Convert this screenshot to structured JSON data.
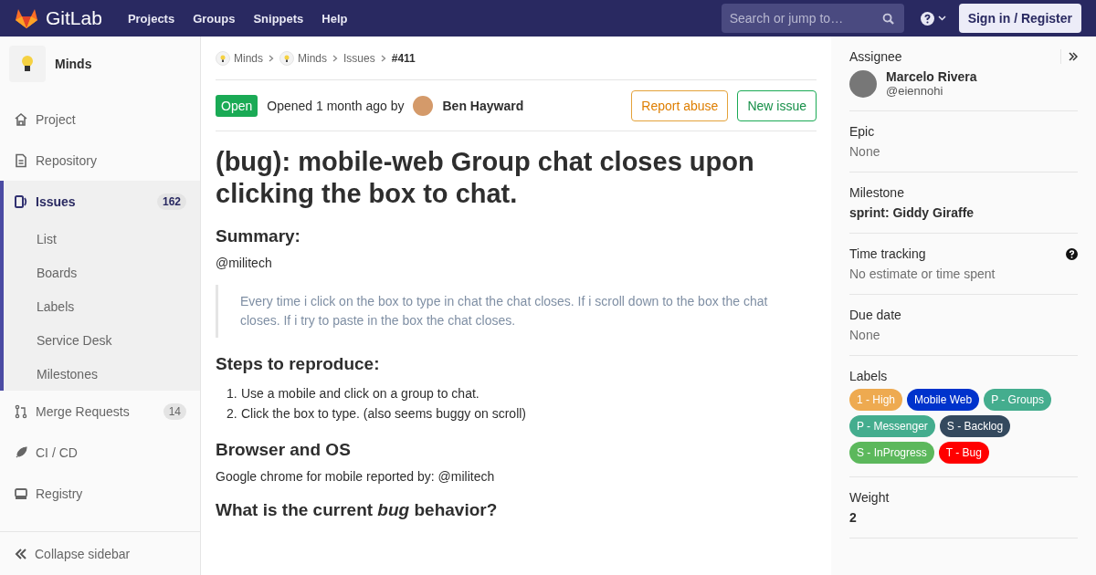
{
  "topbar": {
    "brand": "GitLab",
    "nav": [
      "Projects",
      "Groups",
      "Snippets",
      "Help"
    ],
    "search": {
      "placeholder": "Search or jump to…"
    },
    "sign_in": "Sign in / Register"
  },
  "sidebar": {
    "project": "Minds",
    "items": [
      {
        "label": "Project",
        "selected": false
      },
      {
        "label": "Repository",
        "selected": false
      },
      {
        "label": "Issues",
        "count": "162",
        "selected": true,
        "children": [
          {
            "label": "List",
            "selected": false
          },
          {
            "label": "Boards",
            "selected": false
          },
          {
            "label": "Labels",
            "selected": false
          },
          {
            "label": "Service Desk",
            "selected": false
          },
          {
            "label": "Milestones",
            "selected": false
          }
        ]
      },
      {
        "label": "Merge Requests",
        "count": "14",
        "selected": false
      },
      {
        "label": "CI / CD",
        "selected": false
      },
      {
        "label": "Registry",
        "selected": false
      }
    ],
    "collapse": "Collapse sidebar"
  },
  "breadcrumb": [
    "Minds",
    "Minds",
    "Issues",
    "#411"
  ],
  "issue": {
    "status": "Open",
    "opened": "Opened 1 month ago by",
    "author": "Ben Hayward",
    "buttons": [
      "Report abuse",
      "New issue"
    ],
    "title": "(bug): mobile-web Group chat closes upon clicking the box to chat.",
    "body": [
      {
        "kind": "heading",
        "text": "Summary:"
      },
      {
        "kind": "paragraph",
        "text": "@militech"
      },
      {
        "kind": "quote",
        "text": "Every time i click on the box to type in chat the chat closes. If i scroll down to the box the chat closes. If i try to paste in the box the chat closes."
      },
      {
        "kind": "heading",
        "text": "Steps to reproduce:"
      },
      {
        "kind": "list",
        "items": [
          {
            "marker": "1.",
            "text": "Use a mobile and click on a group to chat."
          },
          {
            "marker": "2.",
            "text": "Click the box to type. (also seems buggy on scroll)"
          }
        ]
      },
      {
        "kind": "heading",
        "text": "Browser and OS"
      },
      {
        "kind": "paragraph",
        "text": "Google chrome for mobile reported by: @militech"
      },
      {
        "kind": "heading",
        "text": "What is the current *bug* behavior?"
      }
    ]
  },
  "right_sidebar": {
    "assignee": {
      "title": "Assignee",
      "name": "Marcelo Rivera",
      "handle": "@eiennohi"
    },
    "sections": [
      {
        "kind": "plain",
        "title": "Epic",
        "value": "None"
      },
      {
        "kind": "bold",
        "title": "Milestone",
        "value": "sprint: Giddy Giraffe"
      },
      {
        "kind": "help",
        "title": "Time tracking",
        "value": "No estimate or time spent"
      },
      {
        "kind": "plain",
        "title": "Due date",
        "value": "None"
      },
      {
        "kind": "labels",
        "title": "Labels",
        "labels": [
          {
            "text": "1 - High",
            "color": "#eeaa50"
          },
          {
            "text": "Mobile Web",
            "color": "#0033cc"
          },
          {
            "text": "P - Groups",
            "color": "#44ad8e"
          },
          {
            "text": "P - Messenger",
            "color": "#44ad8e"
          },
          {
            "text": "S - Backlog",
            "color": "#34495e"
          },
          {
            "text": "S - InProgress",
            "color": "#5cb85c"
          },
          {
            "text": "T - Bug",
            "color": "#ff0000"
          }
        ]
      },
      {
        "kind": "bold",
        "title": "Weight",
        "value": "2"
      }
    ]
  }
}
